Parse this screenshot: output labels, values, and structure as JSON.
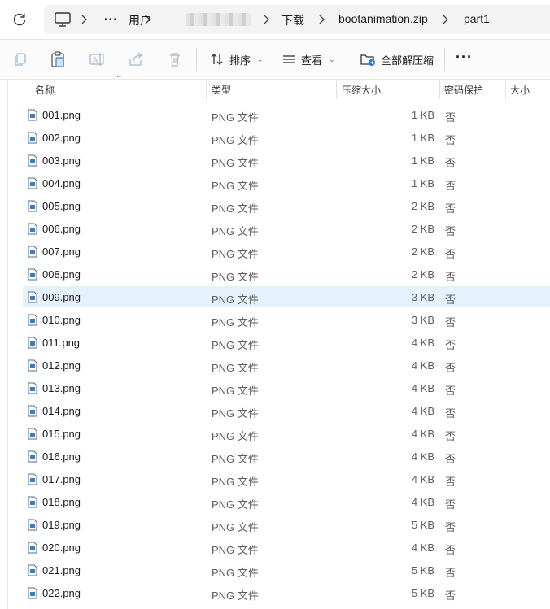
{
  "address_bar": {
    "refresh_icon": "refresh-icon",
    "pc_icon": "computer-icon",
    "crumbs": [
      "···",
      "用户",
      "下载",
      "bootanimation.zip",
      "part1"
    ]
  },
  "toolbar": {
    "copy_icon": "copy-icon",
    "paste_icon": "clipboard-icon",
    "rename_icon": "rename-icon",
    "share_icon": "share-icon",
    "delete_icon": "trash-icon",
    "sort_label": "排序",
    "view_label": "查看",
    "extract_label": "全部解压缩",
    "more_label": "···"
  },
  "columns": {
    "name": "名称",
    "type": "类型",
    "compressed_size": "压缩大小",
    "password": "密码保护",
    "size": "大小"
  },
  "files": [
    {
      "name": "001.png",
      "type": "PNG 文件",
      "size": "1 KB",
      "protected": "否"
    },
    {
      "name": "002.png",
      "type": "PNG 文件",
      "size": "1 KB",
      "protected": "否"
    },
    {
      "name": "003.png",
      "type": "PNG 文件",
      "size": "1 KB",
      "protected": "否"
    },
    {
      "name": "004.png",
      "type": "PNG 文件",
      "size": "1 KB",
      "protected": "否"
    },
    {
      "name": "005.png",
      "type": "PNG 文件",
      "size": "2 KB",
      "protected": "否"
    },
    {
      "name": "006.png",
      "type": "PNG 文件",
      "size": "2 KB",
      "protected": "否"
    },
    {
      "name": "007.png",
      "type": "PNG 文件",
      "size": "2 KB",
      "protected": "否"
    },
    {
      "name": "008.png",
      "type": "PNG 文件",
      "size": "2 KB",
      "protected": "否"
    },
    {
      "name": "009.png",
      "type": "PNG 文件",
      "size": "3 KB",
      "protected": "否"
    },
    {
      "name": "010.png",
      "type": "PNG 文件",
      "size": "3 KB",
      "protected": "否"
    },
    {
      "name": "011.png",
      "type": "PNG 文件",
      "size": "4 KB",
      "protected": "否"
    },
    {
      "name": "012.png",
      "type": "PNG 文件",
      "size": "4 KB",
      "protected": "否"
    },
    {
      "name": "013.png",
      "type": "PNG 文件",
      "size": "4 KB",
      "protected": "否"
    },
    {
      "name": "014.png",
      "type": "PNG 文件",
      "size": "4 KB",
      "protected": "否"
    },
    {
      "name": "015.png",
      "type": "PNG 文件",
      "size": "4 KB",
      "protected": "否"
    },
    {
      "name": "016.png",
      "type": "PNG 文件",
      "size": "4 KB",
      "protected": "否"
    },
    {
      "name": "017.png",
      "type": "PNG 文件",
      "size": "4 KB",
      "protected": "否"
    },
    {
      "name": "018.png",
      "type": "PNG 文件",
      "size": "4 KB",
      "protected": "否"
    },
    {
      "name": "019.png",
      "type": "PNG 文件",
      "size": "5 KB",
      "protected": "否"
    },
    {
      "name": "020.png",
      "type": "PNG 文件",
      "size": "4 KB",
      "protected": "否"
    },
    {
      "name": "021.png",
      "type": "PNG 文件",
      "size": "5 KB",
      "protected": "否"
    },
    {
      "name": "022.png",
      "type": "PNG 文件",
      "size": "5 KB",
      "protected": "否"
    }
  ],
  "selected_file": "009.png",
  "colors": {
    "selection": "#e6f2fb",
    "accent": "#1a73d9"
  }
}
